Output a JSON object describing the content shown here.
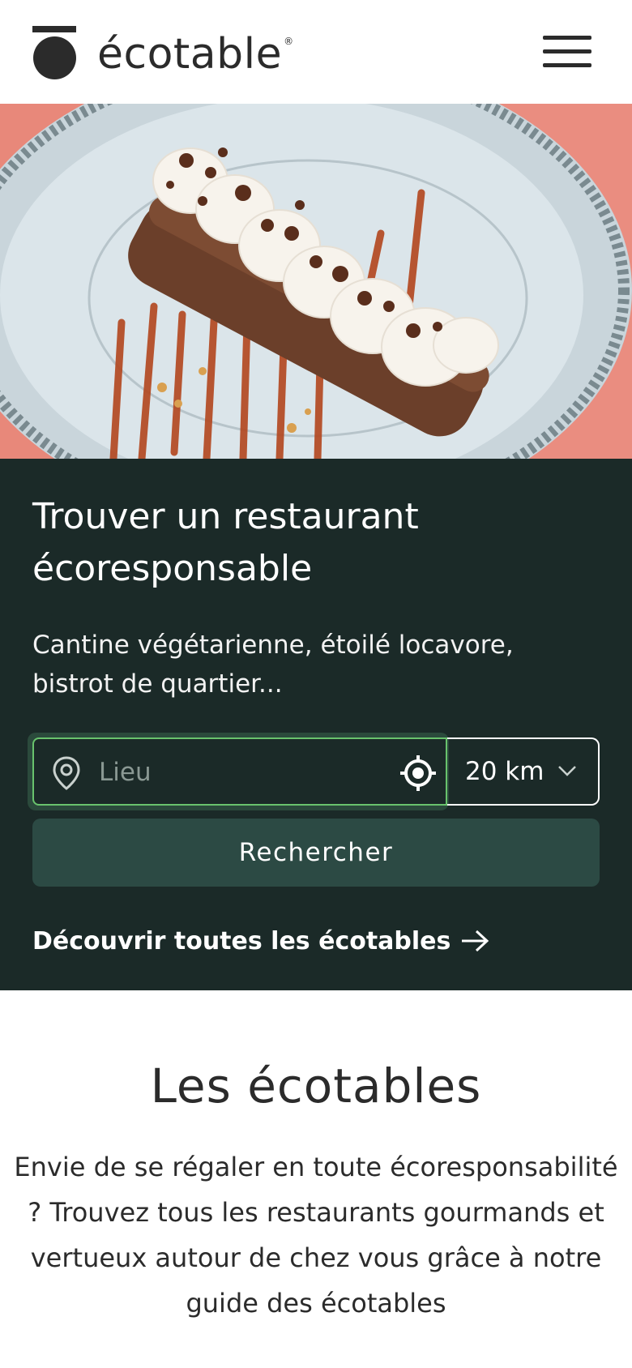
{
  "header": {
    "brand": "écotable",
    "registered": "®",
    "menu_icon": "hamburger-menu-icon"
  },
  "hero": {
    "image_subject": "plated dessert",
    "colors": {
      "background": "#e8887a",
      "plate": "#d9e3e8",
      "cake": "#6b3f2a",
      "cream": "#f7f3ec",
      "caramel": "#b3461e"
    }
  },
  "search_panel": {
    "title_line1": "Trouver un restaurant",
    "title_line2": "écoresponsable",
    "subtitle": "Cantine végétarienne, étoilé locavore, bistrot de quartier...",
    "location_placeholder": "Lieu",
    "location_value": "",
    "radius_selected": "20 km",
    "search_button": "Rechercher",
    "discover_link": "Découvrir toutes les écotables",
    "colors": {
      "panel_bg": "#1b2a28",
      "focus_border": "#69c36d",
      "button_bg": "#2c4a44"
    }
  },
  "intro": {
    "title": "Les écotables",
    "text": "Envie de se régaler en toute écoresponsabilité ? Trouvez tous les restaurants gourmands et vertueux autour de chez vous grâce à notre guide des écotables"
  }
}
